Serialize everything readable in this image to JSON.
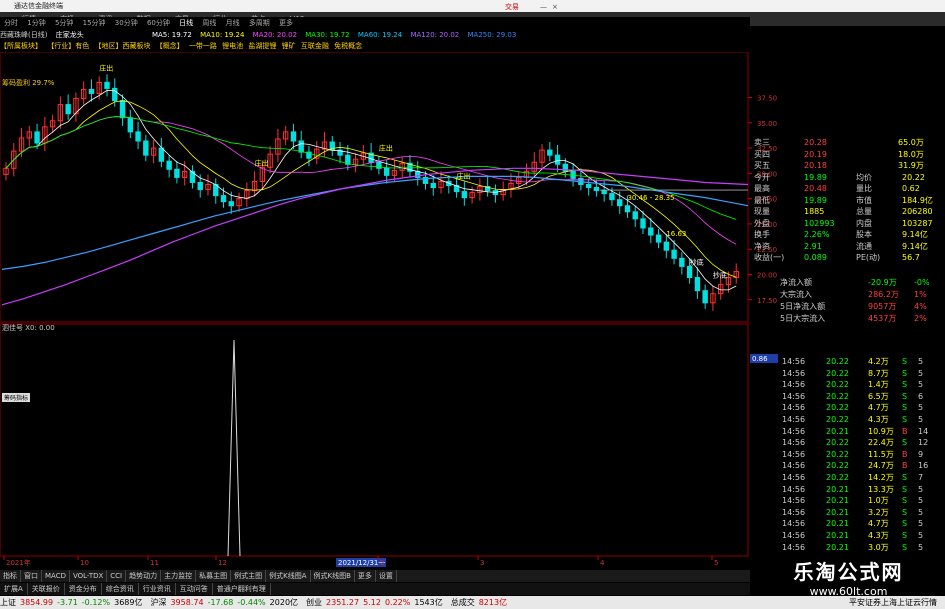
{
  "titlebar": {
    "title": "通达信金融终端",
    "menu_right": "交易"
  },
  "menubar": [
    "行情",
    "市场",
    "资讯",
    "数据",
    "交易",
    "行业",
    "热点",
    "LI12"
  ],
  "periods": [
    "分时",
    "1分钟",
    "5分钟",
    "15分钟",
    "30分钟",
    "60分钟",
    "日线",
    "周线",
    "月线",
    "多周期",
    "更多"
  ],
  "ma_bar": {
    "stock": "西藏珠峰(日线)",
    "indicator": "庄家龙头",
    "ma5": "MA5: 19.72",
    "ma10": "MA10: 19.24",
    "ma20": "MA20: 20.02",
    "ma30": "MA30: 19.72",
    "ma60": "MA60: 19.24",
    "ma120": "MA120: 20.02",
    "ma250": "MA250: 29.03"
  },
  "tags": [
    "【所属板块】",
    "【行业】有色",
    "【地区】西藏板块",
    "【概念】",
    "一带一路",
    "锂电池",
    "盐湖提锂",
    "锂矿",
    "互联金融",
    "免税概念"
  ],
  "chart_data": {
    "type": "candlestick",
    "title": "西藏珠峰(日线)",
    "y_ticks": [
      "37.50",
      "35.00",
      "32.50",
      "30.00",
      "27.50",
      "25.00",
      "22.50",
      "20.00",
      "17.50"
    ],
    "y_range": [
      15.5,
      42.0
    ],
    "x_labels": [
      "2021年",
      "10",
      "11",
      "12",
      "2021/12/31一",
      "2",
      "3",
      "4",
      "5"
    ],
    "annotations": [
      "筹码盈利 29.7%",
      "庄出",
      "庄出",
      "庄出",
      "庄出",
      "抄底",
      "抄底",
      "16.63",
      "30.46 - 28.35"
    ],
    "closes": [
      30.5,
      32.2,
      33.5,
      34.1,
      33.0,
      34.6,
      35.2,
      36.8,
      35.9,
      37.4,
      38.3,
      37.9,
      39.0,
      38.4,
      37.2,
      35.5,
      34.1,
      33.2,
      31.8,
      32.5,
      31.2,
      30.4,
      29.6,
      30.2,
      29.1,
      28.4,
      28.9,
      27.8,
      27.2,
      26.8,
      27.5,
      28.3,
      29.2,
      30.6,
      31.9,
      33.4,
      34.1,
      33.2,
      32.1,
      31.5,
      32.4,
      33.1,
      32.3,
      31.8,
      30.9,
      31.4,
      32.0,
      31.1,
      30.5,
      29.8,
      30.3,
      31.0,
      30.2,
      29.6,
      29.0,
      28.6,
      29.2,
      28.8,
      28.2,
      27.6,
      28.1,
      28.7,
      28.3,
      27.9,
      28.4,
      29.0,
      29.6,
      30.2,
      31.1,
      32.3,
      31.8,
      30.9,
      30.2,
      29.5,
      28.9,
      28.6,
      28.3,
      28.0,
      27.4,
      26.8,
      26.2,
      25.5,
      24.6,
      23.9,
      23.2,
      22.4,
      21.6,
      20.8,
      19.7,
      18.4,
      17.2,
      18.1,
      19.0,
      19.7,
      20.3
    ],
    "ma_series": [
      {
        "name": "MA250",
        "color": "#3aa0ff",
        "values": [
          20.5,
          20.8,
          21.2,
          21.7,
          22.2,
          22.8,
          23.4,
          24.0,
          24.6,
          25.2,
          25.8,
          26.3,
          26.8,
          27.3,
          27.7,
          28.1,
          28.5,
          28.8,
          29.1,
          29.3,
          29.5,
          29.6,
          29.7,
          29.7,
          29.7,
          29.6,
          29.4,
          29.2,
          29.0,
          28.8,
          28.5,
          28.2,
          27.9,
          27.6,
          27.2,
          26.8
        ]
      },
      {
        "name": "MA120",
        "color": "#c93cff",
        "values": [
          17.0,
          17.6,
          18.3,
          19.0,
          19.8,
          20.6,
          21.4,
          22.3,
          23.2,
          24.0,
          24.8,
          25.5,
          26.2,
          26.9,
          27.5,
          28.0,
          28.5,
          28.9,
          29.3,
          29.6,
          29.9,
          30.1,
          30.3,
          30.4,
          30.5,
          30.5,
          30.4,
          30.3,
          30.1,
          29.9,
          29.7,
          29.5,
          29.3,
          29.1,
          29.0,
          28.9
        ]
      }
    ],
    "sub_indicator": {
      "name": "泗佳号",
      "value": "X0: 0.00",
      "spike_label": "0.86"
    }
  },
  "quote": {
    "rows": [
      {
        "label": "卖三",
        "value": "20.28",
        "vol": "65.0万"
      },
      {
        "label": "买四",
        "value": "20.19",
        "vol": "18.0万"
      },
      {
        "label": "买五",
        "value": "20.18",
        "vol": "31.9万"
      },
      {
        "label": "今开",
        "value": "19.89",
        "label2": "均价",
        "value2": "20.22"
      },
      {
        "label": "最高",
        "value": "20.48",
        "label2": "量比",
        "value2": "0.62"
      },
      {
        "label": "最低",
        "value": "19.89",
        "label2": "市值",
        "value2": "184.9亿"
      },
      {
        "label": "现量",
        "value": "1885",
        "label2": "总量",
        "value2": "206280"
      },
      {
        "label": "外盘",
        "value": "102993",
        "label2": "内盘",
        "value2": "103287"
      },
      {
        "label": "换手",
        "value": "2.26%",
        "label2": "股本",
        "value2": "9.14亿"
      },
      {
        "label": "净资",
        "value": "2.91",
        "label2": "流通",
        "value2": "9.14亿"
      },
      {
        "label": "收益(一)",
        "value": "0.089",
        "label2": "PE(动)",
        "value2": "56.7"
      }
    ],
    "flows": [
      {
        "label": "净流入额",
        "value": "-20.9万",
        "pct": "-0%"
      },
      {
        "label": "大宗流入",
        "value": "286.2万",
        "pct": "1%"
      },
      {
        "label": "5日净流入额",
        "value": "9057万",
        "pct": "4%"
      },
      {
        "label": "5日大宗流入",
        "value": "4537万",
        "pct": "2%"
      }
    ]
  },
  "ticks": [
    {
      "t": "14:56",
      "p": "20.22",
      "v": "4.2万",
      "s": "S",
      "n": "5"
    },
    {
      "t": "14:56",
      "p": "20.22",
      "v": "8.7万",
      "s": "S",
      "n": "5"
    },
    {
      "t": "14:56",
      "p": "20.22",
      "v": "1.4万",
      "s": "S",
      "n": "5"
    },
    {
      "t": "14:56",
      "p": "20.22",
      "v": "6.5万",
      "s": "S",
      "n": "6"
    },
    {
      "t": "14:56",
      "p": "20.22",
      "v": "4.7万",
      "s": "S",
      "n": "5"
    },
    {
      "t": "14:56",
      "p": "20.22",
      "v": "4.3万",
      "s": "S",
      "n": "5"
    },
    {
      "t": "14:56",
      "p": "20.21",
      "v": "10.9万",
      "s": "B",
      "n": "14"
    },
    {
      "t": "14:56",
      "p": "20.22",
      "v": "22.4万",
      "s": "S",
      "n": "12"
    },
    {
      "t": "14:56",
      "p": "20.22",
      "v": "11.5万",
      "s": "B",
      "n": "9"
    },
    {
      "t": "14:56",
      "p": "20.22",
      "v": "24.7万",
      "s": "B",
      "n": "16"
    },
    {
      "t": "14:56",
      "p": "20.22",
      "v": "14.2万",
      "s": "S",
      "n": "7"
    },
    {
      "t": "14:56",
      "p": "20.21",
      "v": "13.3万",
      "s": "S",
      "n": "5"
    },
    {
      "t": "14:56",
      "p": "20.21",
      "v": "1.0万",
      "s": "S",
      "n": "5"
    },
    {
      "t": "14:56",
      "p": "20.21",
      "v": "3.2万",
      "s": "S",
      "n": "5"
    },
    {
      "t": "14:56",
      "p": "20.21",
      "v": "4.7万",
      "s": "S",
      "n": "5"
    },
    {
      "t": "14:56",
      "p": "20.21",
      "v": "4.3万",
      "s": "S",
      "n": "5"
    },
    {
      "t": "14:56",
      "p": "20.21",
      "v": "3.0万",
      "s": "S",
      "n": "5"
    }
  ],
  "bottom_tabs": [
    "指标",
    "窗口",
    "MACD",
    "VOL-TDX",
    "CCI",
    "趋势动力",
    "主力监控",
    "私募主图",
    "例式主图",
    "例式K线图A",
    "例式K线图B",
    "更多",
    "设置"
  ],
  "bottom_tabs2": [
    "扩展A",
    "关联报价",
    "资金分布",
    "综合资讯",
    "行业资讯",
    "互动问答",
    "普通户翻利有理"
  ],
  "left_side_label": "筹码盈利 29.7%",
  "sub_box_label": "筹码指标",
  "statusbar": [
    {
      "label": "上证",
      "value": "3854.99",
      "chg": "-3.71",
      "pct": "-0.12%",
      "amt": "3689亿"
    },
    {
      "label": "沪深",
      "value": "3958.74",
      "chg": "-17.68",
      "pct": "-0.44%",
      "amt": "2020亿"
    },
    {
      "label": "创业",
      "value": "2351.27",
      "chg": "5.12",
      "pct": "0.22%",
      "amt": "1543亿"
    },
    {
      "label": "总成交",
      "value": "8213亿",
      "chg": "",
      "pct": "",
      "amt": ""
    }
  ],
  "status_right": "平安证券上海上证云行情",
  "watermark": {
    "line1": "乐淘公式网",
    "line2": "www.60lt.com"
  },
  "colors": {
    "up": "#ff3030",
    "down": "#00e0e0",
    "ma5": "#ffffff",
    "ma10": "#ffff00",
    "ma20": "#ff44ff",
    "ma30": "#00ff00",
    "grid": "#8b0000",
    "text_yellow": "#ffd200"
  }
}
